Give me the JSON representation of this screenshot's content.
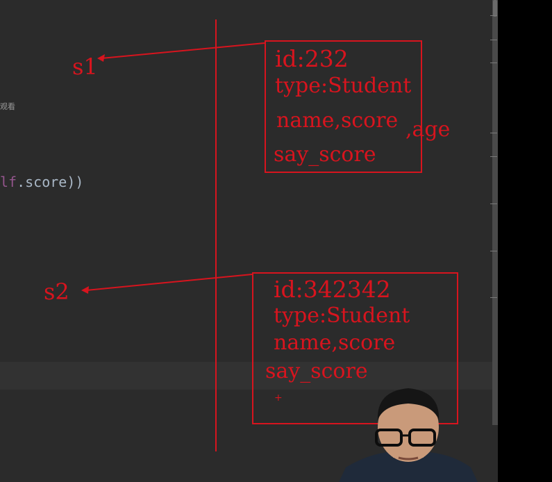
{
  "editor": {
    "side_hint": "观看",
    "code_self_fragment": "lf",
    "code_rest": ".score))"
  },
  "annotation": {
    "ink_color": "#d8141e",
    "s1": {
      "label": "s1",
      "id": "id:232",
      "type": "type:Student",
      "attrs": "name,score",
      "extra_attr": ",age",
      "method": "say_score"
    },
    "s2": {
      "label": "s2",
      "id": "id:342342",
      "type": "type:Student",
      "attrs": "name,score",
      "method": "say_score",
      "cursor": "+"
    }
  },
  "presenter": {
    "shirt_color": "#1f2a3a",
    "skin_color": "#c99a7a",
    "hair_color": "#151515"
  }
}
